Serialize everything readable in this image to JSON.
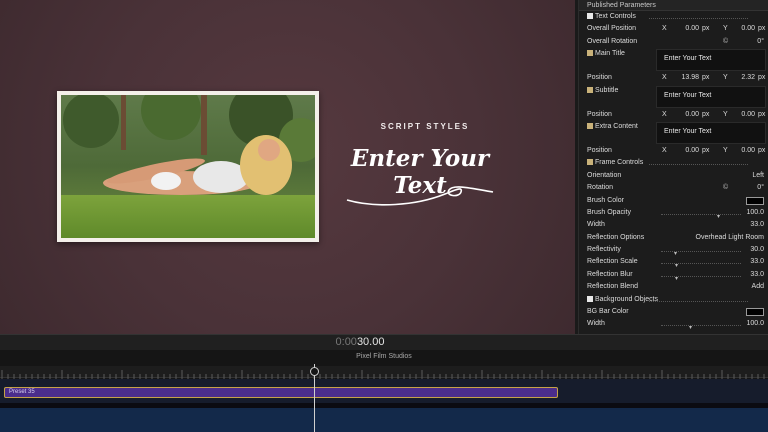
{
  "viewer": {
    "subtitle_text": "SCRIPT STYLES",
    "main_text": "Enter Your Text"
  },
  "panel": {
    "title": "Published Parameters",
    "sections": {
      "text_controls": "Text Controls",
      "frame_controls": "Frame Controls",
      "background_objects": "Background Objects"
    },
    "overall_position": {
      "label": "Overall Position",
      "x": "0.00",
      "y": "0.00",
      "unit": "px"
    },
    "overall_rotation": {
      "label": "Overall Rotation",
      "value": "0°"
    },
    "main_title": {
      "label": "Main Title",
      "value": "Enter Your Text"
    },
    "main_title_position": {
      "label": "Position",
      "x": "13.98",
      "y": "2.32",
      "unit": "px"
    },
    "subtitle": {
      "label": "Subtitle",
      "value": "Enter Your Text"
    },
    "subtitle_position": {
      "label": "Position",
      "x": "0.00",
      "y": "0.00",
      "unit": "px"
    },
    "extra_content": {
      "label": "Extra Content",
      "value": "Enter Your Text"
    },
    "extra_content_position": {
      "label": "Position",
      "x": "0.00",
      "y": "0.00",
      "unit": "px"
    },
    "orientation": {
      "label": "Orientation",
      "value": "Left"
    },
    "rotation": {
      "label": "Rotation",
      "value": "0°"
    },
    "brush_color": {
      "label": "Brush Color",
      "color": "#000000"
    },
    "brush_opacity": {
      "label": "Brush Opacity",
      "value": "100.0"
    },
    "width": {
      "label": "Width",
      "value": "33.0"
    },
    "reflection_options": {
      "label": "Reflection Options",
      "value": "Overhead Light Room"
    },
    "reflectivity": {
      "label": "Reflectivity",
      "value": "30.0"
    },
    "reflection_scale": {
      "label": "Reflection Scale",
      "value": "33.0"
    },
    "reflection_blur": {
      "label": "Reflection Blur",
      "value": "33.0"
    },
    "reflection_blend": {
      "label": "Reflection Blend",
      "value": "Add"
    },
    "bg_bar_color": {
      "label": "BG Bar Color",
      "color": "#000000"
    },
    "bg_width": {
      "label": "Width",
      "value": "100.0"
    },
    "x_label": "X",
    "y_label": "Y"
  },
  "timecode": {
    "dim": "0:00",
    "value": "30.00"
  },
  "timeline": {
    "title": "Pixel Film Studios",
    "clip_label": "Preset 35"
  },
  "colors": {
    "viewer_bg": "#4a3238",
    "clip_fill": "#4b2d8c",
    "clip_border": "#c6a248"
  }
}
